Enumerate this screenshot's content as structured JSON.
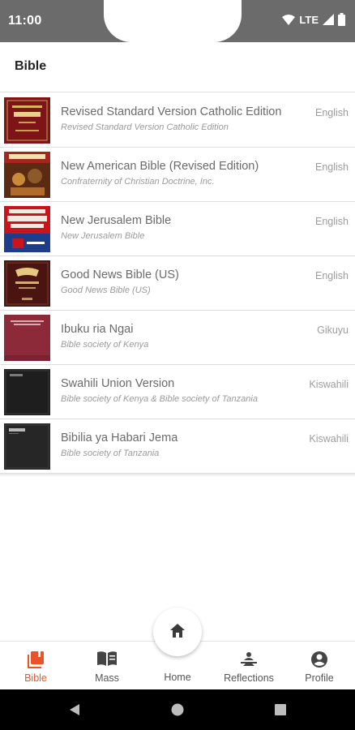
{
  "status": {
    "time": "11:00",
    "network": "LTE"
  },
  "app_bar": {
    "title": "Bible"
  },
  "bibles": [
    {
      "title": "Revised Standard Version Catholic Edition",
      "subtitle": "Revised Standard Version Catholic Edition",
      "language": "English",
      "cover_color": "#7d1418",
      "cover_label": "IGNATIUS BIBLE"
    },
    {
      "title": "New American Bible (Revised Edition)",
      "subtitle": "Confraternity of Christian Doctrine, Inc.",
      "language": "English",
      "cover_color": "#8a1c16",
      "cover_label": "HOLY BIBLE"
    },
    {
      "title": "New Jerusalem Bible",
      "subtitle": "New Jerusalem Bible",
      "language": "English",
      "cover_color": "#c9141c",
      "cover_label": "THE NEW JERUSALEM BIBLE"
    },
    {
      "title": "Good News Bible (US)",
      "subtitle": "Good News Bible (US)",
      "language": "English",
      "cover_color": "#4a1410",
      "cover_label": "Holy Bible"
    },
    {
      "title": "Ibuku ria Ngai",
      "subtitle": "Bible society of Kenya",
      "language": "Gikuyu",
      "cover_color": "#8c2a3a",
      "cover_label": ""
    },
    {
      "title": "Swahili Union Version",
      "subtitle": "Bible society of Kenya & Bible society of Tanzania",
      "language": "Kiswahili",
      "cover_color": "#1e1e1e",
      "cover_label": "BIBLIA"
    },
    {
      "title": "Bibilia ya Habari Jema",
      "subtitle": "Bible society of Tanzania",
      "language": "Kiswahili",
      "cover_color": "#262626",
      "cover_label": "BIBLIA"
    }
  ],
  "bottom_nav": {
    "bible": "Bible",
    "mass": "Mass",
    "home": "Home",
    "reflections": "Reflections",
    "profile": "Profile",
    "active_color": "#e8542a"
  }
}
